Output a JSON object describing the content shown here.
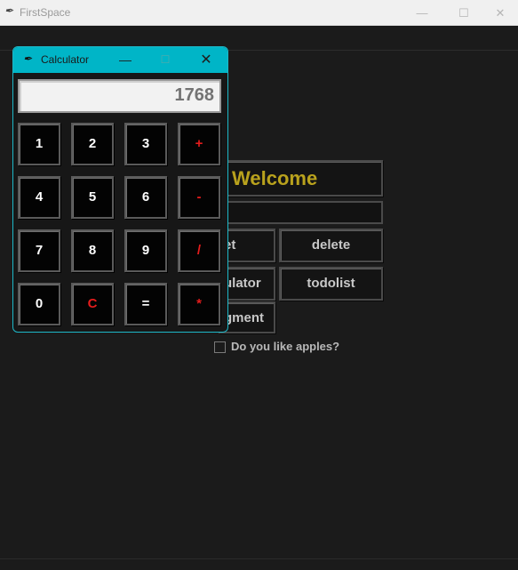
{
  "main_window": {
    "title": "FirstSpace",
    "controls": {
      "minimize": "—",
      "maximize": "☐",
      "close": "✕"
    },
    "welcome_label": "Welcome",
    "name_entry_value": "",
    "buttons": {
      "reset": "et",
      "delete": "delete",
      "calculator": "ulator",
      "todolist": "todolist",
      "assignment": "gment"
    },
    "checkbox": {
      "label": "Do you like apples?",
      "checked": false
    },
    "colors": {
      "background": "#1b1b1b",
      "welcome_text": "#b9a21d"
    }
  },
  "calculator": {
    "title": "Calculator",
    "controls": {
      "minimize": "—",
      "maximize": "☐",
      "close": "✕"
    },
    "display_value": "1768",
    "keys": {
      "k1": "1",
      "k2": "2",
      "k3": "3",
      "plus": "+",
      "k4": "4",
      "k5": "5",
      "k6": "6",
      "minus": "-",
      "k7": "7",
      "k8": "8",
      "k9": "9",
      "divide": "/",
      "k0": "0",
      "clear": "C",
      "equals": "=",
      "multiply": "*"
    },
    "colors": {
      "titlebar": "#00b5c7",
      "operator": "#e51c1c",
      "key_text": "#ffffff"
    }
  }
}
